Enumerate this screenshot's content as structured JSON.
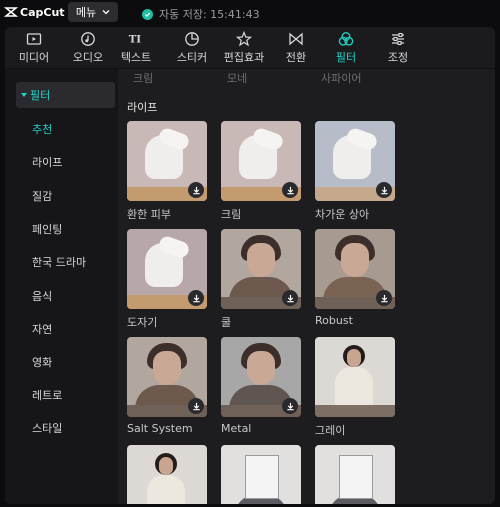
{
  "app": {
    "brand": "CapCut",
    "menu_label": "메뉴",
    "save_status": "자동 저장: 15:41:43"
  },
  "tabs": [
    {
      "label": "미디어",
      "icon": "media-icon"
    },
    {
      "label": "오디오",
      "icon": "audio-icon"
    },
    {
      "label": "텍스트",
      "icon": "text-icon"
    },
    {
      "label": "스티커",
      "icon": "sticker-icon"
    },
    {
      "label": "편집효과",
      "icon": "effects-icon"
    },
    {
      "label": "전환",
      "icon": "transition-icon"
    },
    {
      "label": "필터",
      "icon": "filter-icon",
      "active": true
    },
    {
      "label": "조정",
      "icon": "adjust-icon"
    }
  ],
  "sidebar": {
    "header": "필터",
    "items": [
      "추천",
      "라이프",
      "질감",
      "페인팅",
      "한국 드라마",
      "음식",
      "자연",
      "영화",
      "레트로",
      "스타일"
    ],
    "active": "추천"
  },
  "content": {
    "partial_row": [
      "크림",
      "모네",
      "사파이어"
    ],
    "section_title": "라이프",
    "cards": [
      {
        "label": "환한 피부",
        "art": "sleeve"
      },
      {
        "label": "크림",
        "art": "sleeve"
      },
      {
        "label": "차가운 상아",
        "art": "sleeve-cool"
      },
      {
        "label": "도자기",
        "art": "sleeve-vign"
      },
      {
        "label": "쿨",
        "art": "man"
      },
      {
        "label": "Robust",
        "art": "man-sepia"
      },
      {
        "label": "Salt System",
        "art": "man"
      },
      {
        "label": "Metal",
        "art": "man-metal"
      },
      {
        "label": "그레이",
        "art": "woman"
      },
      {
        "label": "",
        "art": "woman"
      },
      {
        "label": "",
        "art": "news"
      },
      {
        "label": "",
        "art": "news"
      }
    ]
  },
  "colors": {
    "accent": "#22d3c5",
    "panel": "#1b1b1e",
    "background": "#0c0c0e"
  }
}
